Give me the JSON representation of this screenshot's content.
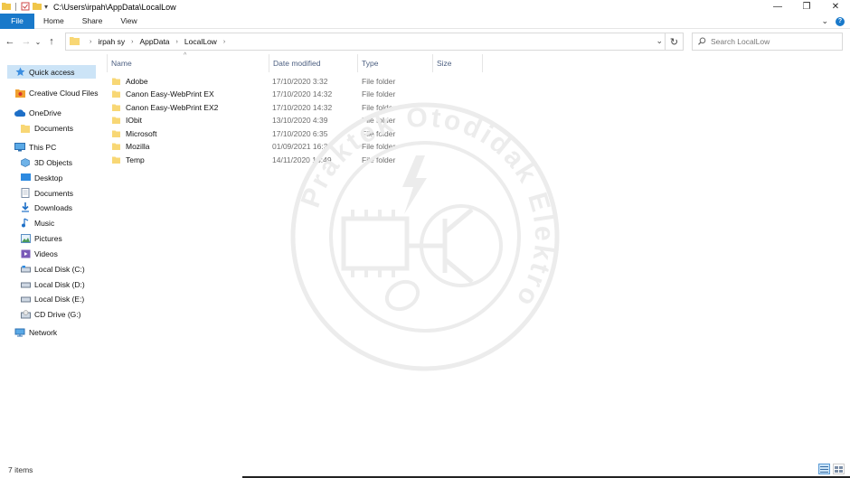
{
  "window": {
    "title": "C:\\Users\\irpah\\AppData\\LocalLow",
    "controls": {
      "minimize": "—",
      "restore": "❐",
      "close": "✕"
    }
  },
  "ribbon": {
    "tabs": [
      "File",
      "Home",
      "Share",
      "View"
    ]
  },
  "nav": {
    "breadcrumb": [
      "irpah sy",
      "AppData",
      "LocalLow"
    ],
    "search_placeholder": "Search LocalLow"
  },
  "sidebar": {
    "items": [
      {
        "label": "Quick access",
        "icon": "star-icon",
        "active": true
      },
      {
        "label": "Creative Cloud Files",
        "icon": "creative-cloud-icon"
      },
      {
        "label": "OneDrive",
        "icon": "cloud-icon"
      },
      {
        "label": "Documents",
        "icon": "folder-icon"
      },
      {
        "label": "This PC",
        "icon": "computer-icon"
      },
      {
        "label": "3D Objects",
        "icon": "cube-icon"
      },
      {
        "label": "Desktop",
        "icon": "desktop-icon"
      },
      {
        "label": "Documents",
        "icon": "documents-icon"
      },
      {
        "label": "Downloads",
        "icon": "download-icon"
      },
      {
        "label": "Music",
        "icon": "music-icon"
      },
      {
        "label": "Pictures",
        "icon": "pictures-icon"
      },
      {
        "label": "Videos",
        "icon": "videos-icon"
      },
      {
        "label": "Local Disk (C:)",
        "icon": "drive-icon"
      },
      {
        "label": "Local Disk (D:)",
        "icon": "drive-icon"
      },
      {
        "label": "Local Disk (E:)",
        "icon": "drive-icon"
      },
      {
        "label": "CD Drive (G:)",
        "icon": "cd-drive-icon"
      },
      {
        "label": "Network",
        "icon": "network-icon"
      }
    ]
  },
  "columns": [
    "Name",
    "Date modified",
    "Type",
    "Size"
  ],
  "files": [
    {
      "name": "Adobe",
      "date": "17/10/2020 3:32",
      "type": "File folder"
    },
    {
      "name": "Canon Easy-WebPrint EX",
      "date": "17/10/2020 14:32",
      "type": "File folder"
    },
    {
      "name": "Canon Easy-WebPrint EX2",
      "date": "17/10/2020 14:32",
      "type": "File folder"
    },
    {
      "name": "IObit",
      "date": "13/10/2020 4:39",
      "type": "File folder"
    },
    {
      "name": "Microsoft",
      "date": "17/10/2020 6:35",
      "type": "File folder"
    },
    {
      "name": "Mozilla",
      "date": "01/09/2021 16:34",
      "type": "File folder"
    },
    {
      "name": "Temp",
      "date": "14/11/2020 18:49",
      "type": "File folder"
    }
  ],
  "status": {
    "item_count": "7 items"
  },
  "watermark": {
    "text": "Praktek Otodidak Elektro"
  },
  "colors": {
    "accent": "#1979ca",
    "folder": "#f8d775",
    "selected": "#cce4f7"
  }
}
